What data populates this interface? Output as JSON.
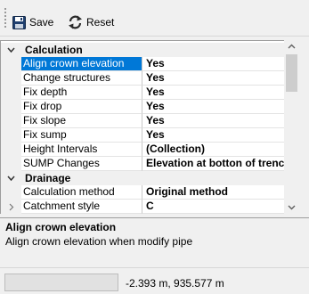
{
  "toolbar": {
    "save_label": "Save",
    "reset_label": "Reset",
    "save_icon": "floppy-disk-icon",
    "reset_icon": "refresh-arrows-icon"
  },
  "categories": {
    "calculation": "Calculation",
    "drainage": "Drainage"
  },
  "calculation_properties": [
    {
      "name": "Align crown elevation",
      "value": "Yes"
    },
    {
      "name": "Change structures",
      "value": "Yes"
    },
    {
      "name": "Fix depth",
      "value": "Yes"
    },
    {
      "name": "Fix drop",
      "value": "Yes"
    },
    {
      "name": "Fix slope",
      "value": "Yes"
    },
    {
      "name": "Fix sump",
      "value": "Yes"
    },
    {
      "name": "Height Intervals",
      "value": "(Collection)"
    },
    {
      "name": "SUMP Changes",
      "value": "Elevation at botton of trenc"
    }
  ],
  "drainage_properties": [
    {
      "name": "Calculation method",
      "value": "Original method"
    },
    {
      "name": "Catchment style",
      "value": "C"
    }
  ],
  "description": {
    "title": "Align crown elevation",
    "text": "Align crown elevation when modify pipe"
  },
  "status": {
    "coordinates": "-2.393 m, 935.577 m"
  },
  "colors": {
    "selection": "#0078d7",
    "background": "#f0f0f0"
  }
}
